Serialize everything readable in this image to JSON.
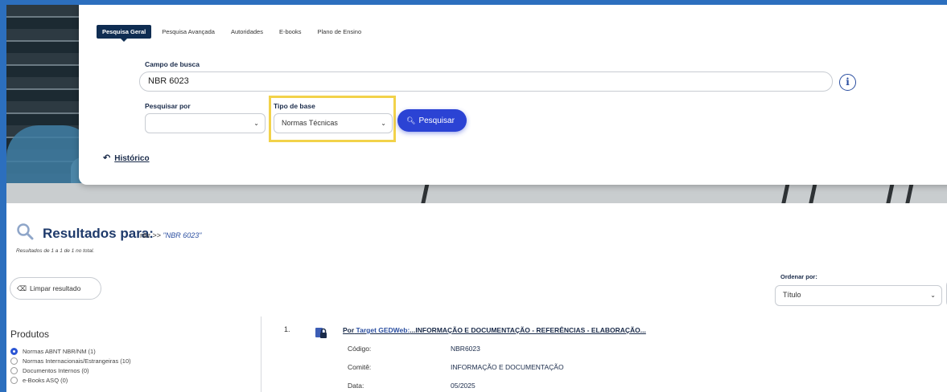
{
  "tabs": [
    {
      "label": "Pesquisa Geral"
    },
    {
      "label": "Pesquisa Avançada"
    },
    {
      "label": "Autoridades"
    },
    {
      "label": "E-books"
    },
    {
      "label": "Plano de Ensino"
    }
  ],
  "search": {
    "field_label": "Campo de busca",
    "value": "NBR 6023",
    "info_icon": "i",
    "search_by_label": "Pesquisar por",
    "search_by_value": "",
    "base_type_label": "Tipo de base",
    "base_type_value": "Normas Técnicas",
    "search_button": "Pesquisar",
    "history_label": "Histórico"
  },
  "results": {
    "title": "Resultados para:",
    "query_prefix": "nbr >>",
    "query": "\"NBR 6023\"",
    "count_text": "Resultados de 1 a 1 de 1 no total.",
    "clear_button": "Limpar resultado",
    "order_label": "Ordenar por:",
    "order_value": "Título"
  },
  "sidebar": {
    "title": "Produtos",
    "items": [
      {
        "label": "Normas ABNT NBR/NM (1)",
        "selected": true
      },
      {
        "label": "Normas Internacionais/Estrangeiras (10)",
        "selected": false
      },
      {
        "label": "Documentos Internos (0)",
        "selected": false
      },
      {
        "label": "e-Books ASQ (0)",
        "selected": false
      }
    ]
  },
  "result_item": {
    "number": "1.",
    "by": "Por",
    "source": "Target GEDWeb:",
    "title": "...INFORMAÇÃO E DOCUMENTAÇÃO - REFERÊNCIAS - ELABORAÇÃO...",
    "fields": [
      {
        "label": "Código:",
        "value": "NBR6023"
      },
      {
        "label": "Comitê:",
        "value": "INFORMAÇÃO E DOCUMENTAÇÃO"
      },
      {
        "label": "Data:",
        "value": "05/2025"
      }
    ]
  },
  "colors": {
    "frame": "#2c6fbe",
    "nav_active": "#0f2d52",
    "primary_button": "#2b43d4",
    "highlight": "#f2d24a"
  }
}
